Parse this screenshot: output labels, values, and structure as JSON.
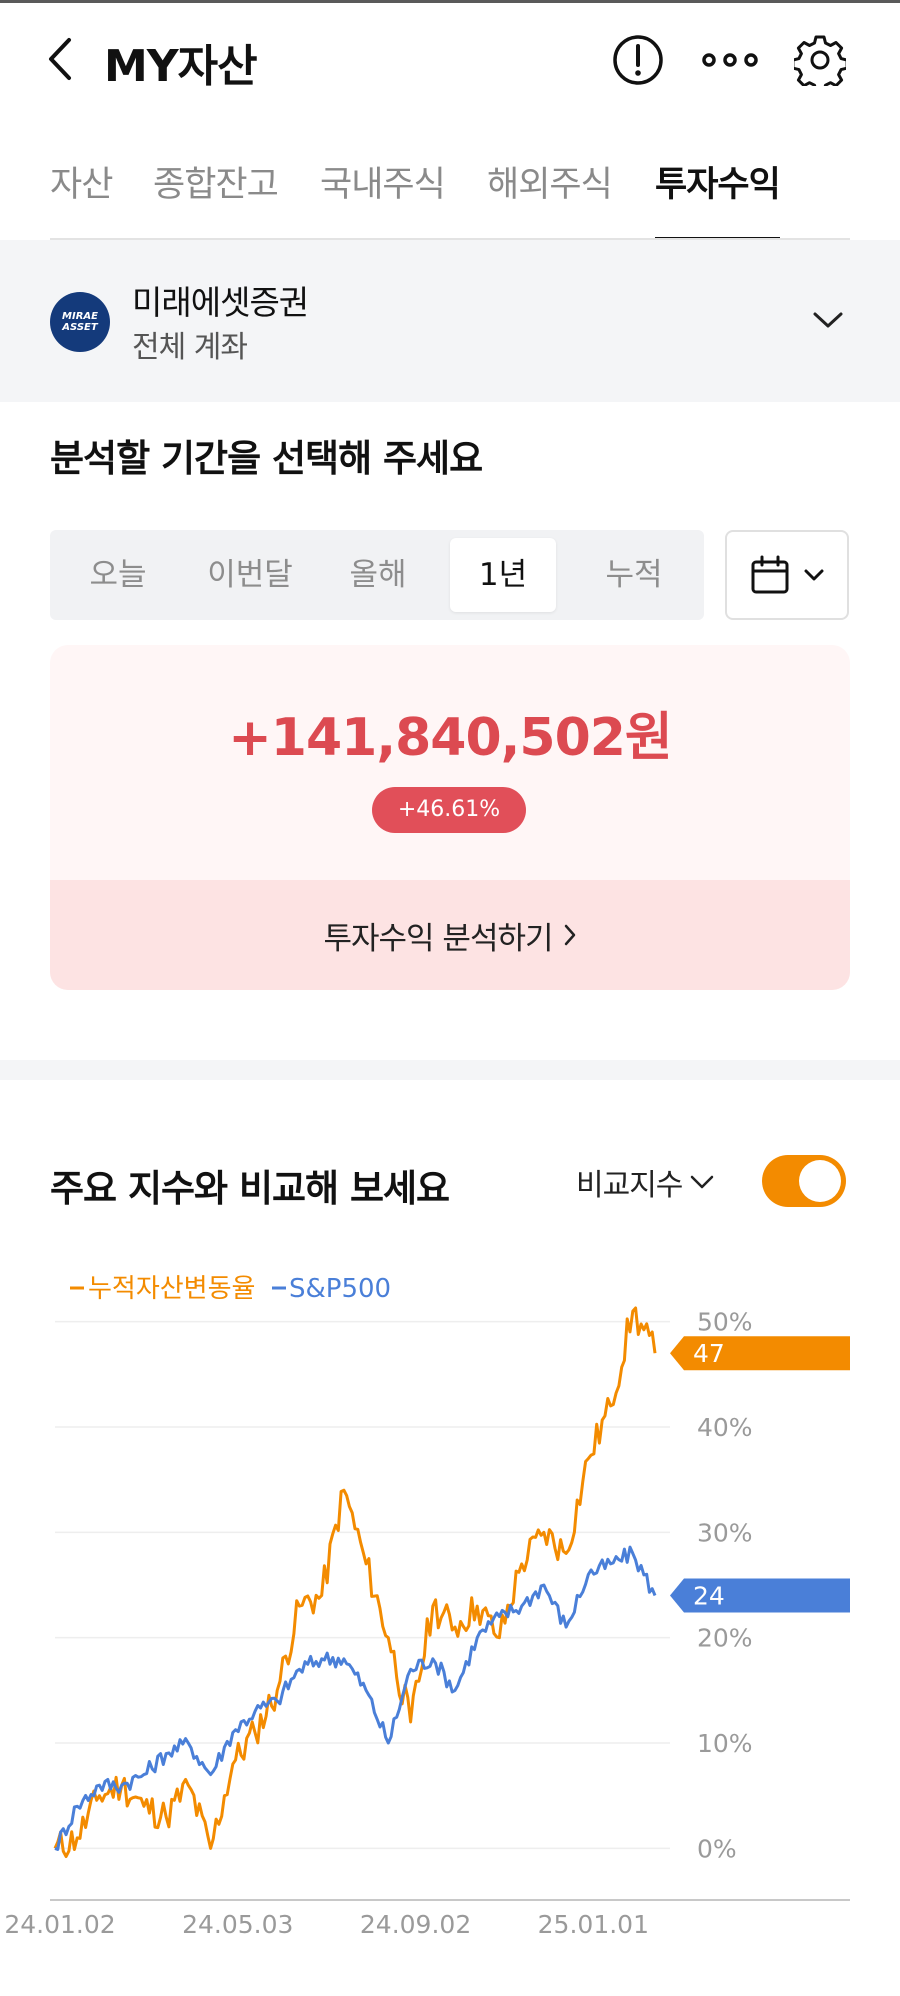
{
  "header": {
    "title": "MY자산"
  },
  "tabs": [
    {
      "label": "자산"
    },
    {
      "label": "종합잔고"
    },
    {
      "label": "국내주식"
    },
    {
      "label": "해외주식"
    },
    {
      "label": "투자수익"
    }
  ],
  "broker": {
    "logo_line1": "MIRAE",
    "logo_line2": "ASSET",
    "name": "미래에셋증권",
    "account": "전체 계좌"
  },
  "period": {
    "title": "분석할 기간을 선택해 주세요",
    "options": [
      {
        "label": "오늘"
      },
      {
        "label": "이번달"
      },
      {
        "label": "올해"
      },
      {
        "label": "1년"
      },
      {
        "label": "누적"
      }
    ],
    "selected": "1년"
  },
  "profit": {
    "amount": "+141,840,502원",
    "rate": "+46.61%",
    "analyze_label": "투자수익 분석하기"
  },
  "compare": {
    "title": "주요 지수와 비교해 보세요",
    "index_label": "비교지수",
    "toggle_on": true
  },
  "colors": {
    "accent_orange": "#f38b00",
    "sp500_blue": "#4a7fd8",
    "profit_red": "#dc4a51"
  },
  "chart_data": {
    "type": "line",
    "x": [
      "24.01.02",
      "24.01.17",
      "24.02.01",
      "24.02.16",
      "24.03.01",
      "24.03.16",
      "24.04.01",
      "24.04.16",
      "24.05.03",
      "24.05.18",
      "24.06.01",
      "24.06.16",
      "24.07.01",
      "24.07.16",
      "24.08.01",
      "24.08.16",
      "24.09.02",
      "24.09.17",
      "24.10.01",
      "24.10.16",
      "24.11.01",
      "24.11.16",
      "24.12.01",
      "24.12.16",
      "25.01.01",
      "25.01.16",
      "25.02.01",
      "25.02.16"
    ],
    "series": [
      {
        "name": "누적자산변동율",
        "values": [
          0,
          1,
          5,
          6,
          4,
          3,
          6,
          0,
          8,
          11,
          15,
          23,
          24,
          34,
          27,
          20,
          12,
          23,
          21,
          23,
          20,
          27,
          30,
          28,
          37,
          42,
          51,
          47
        ]
      },
      {
        "name": "S&P500",
        "values": [
          0,
          4,
          6,
          6,
          7,
          9,
          10,
          7,
          11,
          13,
          14,
          17,
          18,
          18,
          15,
          10,
          17,
          18,
          15,
          20,
          22,
          23,
          25,
          21,
          26,
          27,
          28,
          24
        ]
      }
    ],
    "tick_labels_x": [
      "24.01.02",
      "24.05.03",
      "24.09.02",
      "25.01.01"
    ],
    "tick_labels_y": [
      "0%",
      "10%",
      "20%",
      "30%",
      "40%",
      "50%"
    ],
    "ylim": [
      -3,
      53
    ],
    "last_values": [
      "47",
      "24"
    ],
    "grid": true,
    "legend": "top-left"
  }
}
